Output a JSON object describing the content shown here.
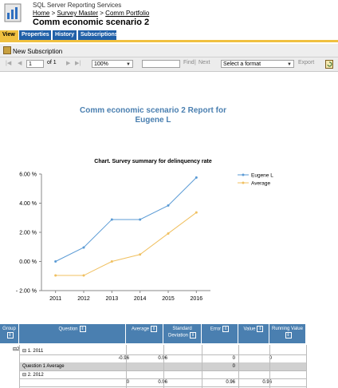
{
  "header": {
    "app_name": "SQL Server Reporting Services",
    "breadcrumb": [
      "Home",
      "Survey Master",
      "Comm Portfolio"
    ],
    "breadcrumb_sep": " > ",
    "page_title": "Comm economic scenario 2"
  },
  "tabs": [
    "View",
    "Properties",
    "History",
    "Subscriptions"
  ],
  "subscription_bar": {
    "new_subscription": "New Subscription"
  },
  "toolbar": {
    "page_current": "1",
    "page_of": "of 1",
    "zoom": "100%",
    "find": "Find",
    "separator": "|",
    "next": "Next",
    "format_select": "Select a format",
    "export": "Export"
  },
  "report": {
    "title_line1": "Comm economic scenario 2 Report for",
    "title_line2": "Eugene L"
  },
  "chart_data": {
    "type": "line",
    "title": "Chart. Survey summary for delinquency rate",
    "categories": [
      "2011",
      "2012",
      "2013",
      "2014",
      "2015",
      "2016"
    ],
    "ylim": [
      -2,
      6
    ],
    "yticks": [
      "6.00 %",
      "4.00 %",
      "2.00 %",
      "0.00 %",
      "- 2.00 %"
    ],
    "ytick_values": [
      6,
      4,
      2,
      0,
      -2
    ],
    "legend_position": "top-right",
    "grid": false,
    "series": [
      {
        "name": "Eugene L",
        "color": "#5b9bd5",
        "values": [
          0.0,
          0.96,
          2.88,
          2.88,
          3.84,
          5.76
        ]
      },
      {
        "name": "Average",
        "color": "#f0c060",
        "values": [
          -0.96,
          -0.96,
          0.0,
          0.48,
          1.92,
          3.36
        ]
      }
    ]
  },
  "table": {
    "headers": [
      "Group",
      "Question",
      "Average",
      "Standard Deviation",
      "Error",
      "Value",
      "Running Value"
    ],
    "group_label": "2",
    "rows": [
      {
        "label": "1. 2011",
        "cells": [
          "",
          "",
          "",
          "",
          ""
        ]
      },
      {
        "label": "",
        "cells": [
          "-0.96",
          "0.96",
          "",
          "0",
          "0"
        ]
      },
      {
        "label": "Question 1 Average",
        "cells": [
          "",
          "",
          "",
          "0",
          ""
        ]
      },
      {
        "label": "2. 2012",
        "cells": [
          "",
          "",
          "",
          "",
          ""
        ]
      },
      {
        "label": "",
        "cells": [
          "0",
          "0.96",
          "",
          "0.96",
          "0.96"
        ]
      }
    ]
  }
}
